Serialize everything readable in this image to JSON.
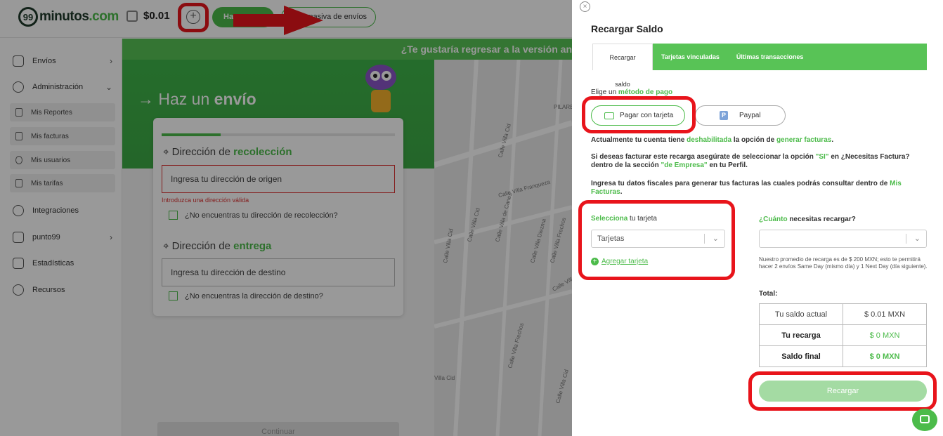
{
  "header": {
    "logo_num": "99",
    "logo_word": "minutos",
    "logo_tld": ".com",
    "balance": "$0.01",
    "btn_make": "Haz",
    "btn_bulk": "masiva de envíos"
  },
  "sidebar": {
    "items": [
      {
        "label": "Envíos"
      },
      {
        "label": "Administración"
      },
      {
        "label": "Integraciones"
      },
      {
        "label": "punto99"
      },
      {
        "label": "Estadísticas"
      },
      {
        "label": "Recursos"
      }
    ],
    "subitems": [
      {
        "label": "Mis Reportes"
      },
      {
        "label": "Mis facturas"
      },
      {
        "label": "Mis usuarios"
      },
      {
        "label": "Mis tarifas"
      }
    ]
  },
  "banner": "¿Te gustaría regresar a la versión an",
  "hero": {
    "title_a": "Haz un ",
    "title_b": "envío"
  },
  "form": {
    "pickup_a": "Dirección de ",
    "pickup_b": "recolección",
    "origin_placeholder": "Ingresa tu dirección de origen",
    "origin_error": "Introduzca una dirección válida",
    "pickup_check": "¿No encuentras tu dirección de recolección?",
    "delivery_a": "Dirección de ",
    "delivery_b": "entrega",
    "dest_placeholder": "Ingresa tu dirección de destino",
    "delivery_check": "¿No encuentras la dirección de destino?",
    "continue": "Continuar"
  },
  "map_streets": [
    "PILARES",
    "Calle Villa Cid",
    "Calle Villa Franqueza",
    "Calle Villa Cid",
    "Calle Villa de Canes",
    "Calle Villa Diezma",
    "Calle Villa Frechos",
    "Calle Villa Cid",
    "Calle Villa General",
    "Calle Villa Frechos",
    "Villa Cid",
    "Calle Villa Cid"
  ],
  "panel": {
    "title": "Recargar Saldo",
    "tabs": [
      {
        "label": "Recargar saldo"
      },
      {
        "label": "Tarjetas vinculadas"
      },
      {
        "label": "Últimas transacciones"
      }
    ],
    "method_a": "Elige un ",
    "method_b": "método de pago",
    "pay_card": "Pagar con tarjeta",
    "pay_paypal": "Paypal",
    "info1_a": "Actualmente tu cuenta tiene ",
    "info1_b": "deshabilitada",
    "info1_c": " la opción de ",
    "info1_d": "generar facturas",
    "info1_e": ".",
    "info2_a": "Si deseas facturar este recarga asegúrate de seleccionar la opción ",
    "info2_b": "\"SI\"",
    "info2_c": " en ¿Necesitas Factura?",
    "info2_d": "dentro de la sección ",
    "info2_e": "\"de Empresa\"",
    "info2_f": " en tu Perfil.",
    "info3_a": "Ingresa tu datos fiscales para generar tus facturas las cuales podrás consultar dentro de ",
    "info3_b": "Mis Facturas",
    "info3_c": ".",
    "select_card_a": "Selecciona",
    "select_card_b": " tu tarjeta",
    "cards_placeholder": "Tarjetas",
    "add_card": "Agregar tarjeta",
    "amount_a": "¿Cuánto",
    "amount_b": " necesitas recargar?",
    "amount_value": "",
    "note": "Nuestro promedio de recarga es de $ 200 MXN; esto te permitirá hacer 2 envíos Same Day (mismo día) y 1 Next Day (día siguiente).",
    "total": "Total:",
    "summary": [
      {
        "label": "Tu saldo actual",
        "value": "$ 0.01 MXN"
      },
      {
        "label": "Tu recarga",
        "value": "$ 0 MXN"
      },
      {
        "label": "Saldo final",
        "value": "$ 0 MXN"
      }
    ],
    "recharge_btn": "Recargar"
  },
  "colors": {
    "brand_green": "#4cbb4a",
    "highlight_red": "#e8141b"
  },
  "icons": [
    "wallet-icon",
    "plus-circle-icon",
    "close-icon",
    "card-icon",
    "paypal-icon",
    "chat-icon",
    "chevron-down-icon",
    "location-pin-icon"
  ]
}
